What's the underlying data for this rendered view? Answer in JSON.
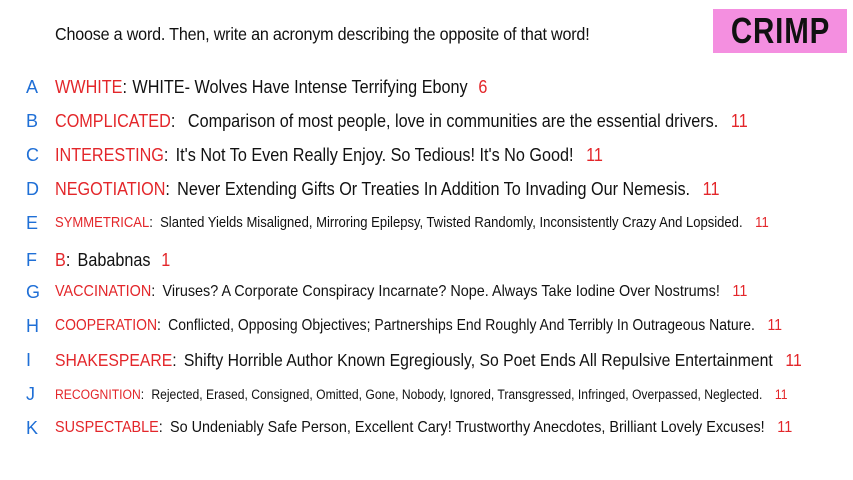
{
  "prompt": "Choose a word. Then, write an acronym describing the opposite of that word!",
  "badge": "CRIMP",
  "colors": {
    "letter": "#1f6fd6",
    "word": "#e3262a",
    "count": "#e3262a",
    "badge_bg": "#f48fe0"
  },
  "entries": [
    {
      "letter": "A",
      "word": "WWHITE",
      "acronym": "WHITE- Wolves Have Intense Terrifying Ebony",
      "count": "6"
    },
    {
      "letter": "B",
      "word": "COMPLICATED",
      "acronym": "Comparison of most people, love in communities are the essential drivers.",
      "count": "11"
    },
    {
      "letter": "C",
      "word": "INTERESTING",
      "acronym": "It's Not To Even Really Enjoy. So Tedious! It's No Good!",
      "count": "11"
    },
    {
      "letter": "D",
      "word": "NEGOTIATION",
      "acronym": "Never Extending Gifts Or Treaties In Addition To Invading Our Nemesis.",
      "count": "11"
    },
    {
      "letter": "E",
      "word": "SYMMETRICAL",
      "acronym": "Slanted Yields Misaligned, Mirroring Epilepsy, Twisted Randomly, Inconsistently Crazy And Lopsided.",
      "count": "11"
    },
    {
      "letter": "F",
      "word": "B",
      "acronym": "Bababnas",
      "count": "1"
    },
    {
      "letter": "G",
      "word": "VACCINATION",
      "acronym": "Viruses? A Corporate Conspiracy Incarnate? Nope. Always Take Iodine Over Nostrums!",
      "count": "11"
    },
    {
      "letter": "H",
      "word": "COOPERATION",
      "acronym": "Conflicted, Opposing Objectives; Partnerships End Roughly And Terribly In Outrageous Nature.",
      "count": "11"
    },
    {
      "letter": "I",
      "word": "SHAKESPEARE",
      "acronym": "Shifty Horrible Author Known Egregiously, So Poet Ends All Repulsive Entertainment",
      "count": "11"
    },
    {
      "letter": "J",
      "word": "RECOGNITION",
      "acronym": "Rejected, Erased, Consigned, Omitted, Gone, Nobody, Ignored, Transgressed, Infringed, Overpassed, Neglected.",
      "count": "11"
    },
    {
      "letter": "K",
      "word": "SUSPECTABLE",
      "acronym": "So Undeniably Safe Person, Excellent Cary! Trustworthy Anecdotes, Brilliant Lovely Excuses!",
      "count": "11"
    }
  ]
}
